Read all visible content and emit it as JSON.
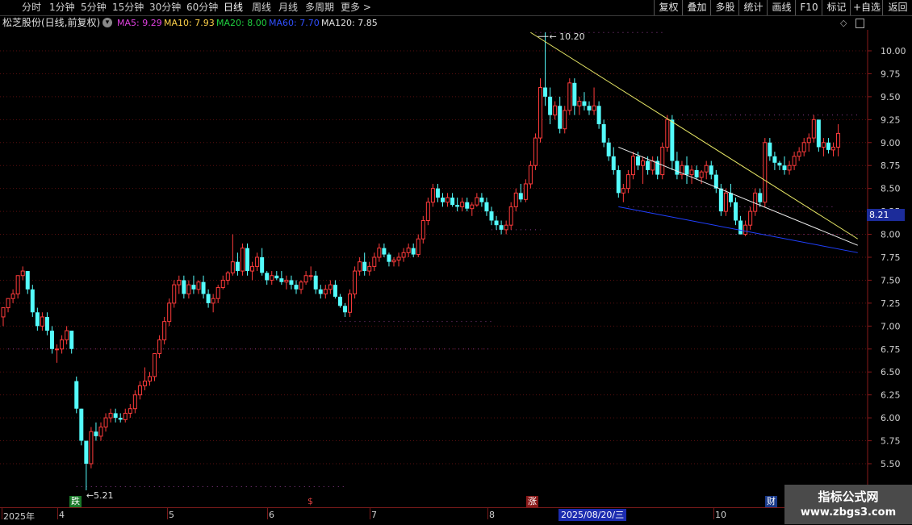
{
  "toolbar": {
    "left_items": [
      "分时",
      "1分钟",
      "5分钟",
      "15分钟",
      "30分钟",
      "60分钟",
      "日线",
      "周线",
      "月线",
      "多周期",
      "更多 >"
    ],
    "active_index": 6,
    "right_items": [
      "复权",
      "叠加",
      "多股",
      "统计",
      "画线",
      "F10",
      "标记",
      "+自选",
      "返回"
    ]
  },
  "info": {
    "title": "松芝股份(日线,前复权)",
    "dropdown_icon": "circle-chevron-down-icon",
    "ma": [
      {
        "label": "MA5: 9.29",
        "color": "#e040e0"
      },
      {
        "label": "MA10: 7.93",
        "color": "#ffd24a"
      },
      {
        "label": "MA20: 8.00",
        "color": "#20d040"
      },
      {
        "label": "MA60: 7.70",
        "color": "#3050ff"
      },
      {
        "label": "MA120: 7.85",
        "color": "#e0e0e0"
      }
    ]
  },
  "colors": {
    "up": "#ff3b3b",
    "down": "#54fcfc",
    "axis": "#8a1a1a",
    "grid": "#5a0f0f"
  },
  "chart_data": {
    "type": "candlestick",
    "stock": "松芝股份",
    "period": "日线",
    "adjust": "前复权",
    "ylim": [
      5.3,
      10.25
    ],
    "y_ticks": [
      10.0,
      9.75,
      9.5,
      9.25,
      9.0,
      8.75,
      8.5,
      8.25,
      8.0,
      7.75,
      7.5,
      7.25,
      7.0,
      6.75,
      6.5,
      6.25,
      6.0,
      5.75,
      5.5
    ],
    "y_tick_labels": [
      "10.00",
      "9.75",
      "9.50",
      "9.25",
      "9.00",
      "8.75",
      "8.50",
      "8.25",
      "8.00",
      "7.75",
      "7.50",
      "7.25",
      "7.00",
      "6.75",
      "6.50",
      "6.25",
      "6.00",
      "5.75",
      "5.50"
    ],
    "current_price_label": "8.21",
    "current_price": 8.21,
    "high_annotation": "10.20",
    "high_value": 10.2,
    "low_annotation": "5.21",
    "low_value": 5.21,
    "x_labels": [
      "2025年",
      "4",
      "5",
      "6",
      "7",
      "8",
      "10"
    ],
    "cursor_date": "2025/08/20/三",
    "markers": [
      {
        "text": "跌",
        "bar": 15,
        "color": "#20c040"
      },
      {
        "text": "$",
        "bar": 64,
        "color": "#e04040"
      },
      {
        "text": "涨",
        "bar": 109,
        "color": "#e04040"
      },
      {
        "text": "财",
        "bar": 159,
        "color": "#4080ff"
      }
    ],
    "candles": [
      [
        7.1,
        7.2,
        7.0,
        7.2
      ],
      [
        7.2,
        7.3,
        7.15,
        7.3
      ],
      [
        7.3,
        7.4,
        7.25,
        7.35
      ],
      [
        7.35,
        7.55,
        7.3,
        7.55
      ],
      [
        7.55,
        7.65,
        7.5,
        7.6
      ],
      [
        7.6,
        7.6,
        7.35,
        7.4
      ],
      [
        7.4,
        7.45,
        7.1,
        7.15
      ],
      [
        7.15,
        7.2,
        6.95,
        7.0
      ],
      [
        7.0,
        7.15,
        6.95,
        7.1
      ],
      [
        7.1,
        7.15,
        6.9,
        6.95
      ],
      [
        6.95,
        7.0,
        6.7,
        6.75
      ],
      [
        6.75,
        6.8,
        6.6,
        6.75
      ],
      [
        6.75,
        6.9,
        6.7,
        6.85
      ],
      [
        6.85,
        7.0,
        6.8,
        6.95
      ],
      [
        6.95,
        6.95,
        6.7,
        6.75
      ],
      [
        6.4,
        6.45,
        6.05,
        6.1
      ],
      [
        6.1,
        6.1,
        5.7,
        5.75
      ],
      [
        5.75,
        5.75,
        5.21,
        5.5
      ],
      [
        5.5,
        5.9,
        5.45,
        5.85
      ],
      [
        5.85,
        5.95,
        5.75,
        5.8
      ],
      [
        5.8,
        5.95,
        5.75,
        5.9
      ],
      [
        5.9,
        6.05,
        5.85,
        6.0
      ],
      [
        6.0,
        6.1,
        5.95,
        6.05
      ],
      [
        6.05,
        6.1,
        5.95,
        6.0
      ],
      [
        6.0,
        6.05,
        5.95,
        5.98
      ],
      [
        5.98,
        6.1,
        5.95,
        6.05
      ],
      [
        6.05,
        6.15,
        6.0,
        6.1
      ],
      [
        6.1,
        6.3,
        6.05,
        6.25
      ],
      [
        6.25,
        6.4,
        6.2,
        6.35
      ],
      [
        6.35,
        6.55,
        6.3,
        6.4
      ],
      [
        6.4,
        6.5,
        6.35,
        6.45
      ],
      [
        6.45,
        6.7,
        6.4,
        6.7
      ],
      [
        6.7,
        6.9,
        6.65,
        6.85
      ],
      [
        6.85,
        7.1,
        6.8,
        7.05
      ],
      [
        7.05,
        7.3,
        7.0,
        7.25
      ],
      [
        7.25,
        7.5,
        7.2,
        7.45
      ],
      [
        7.45,
        7.55,
        7.35,
        7.5
      ],
      [
        7.5,
        7.55,
        7.3,
        7.35
      ],
      [
        7.35,
        7.5,
        7.3,
        7.45
      ],
      [
        7.45,
        7.55,
        7.35,
        7.4
      ],
      [
        7.4,
        7.5,
        7.35,
        7.48
      ],
      [
        7.48,
        7.55,
        7.3,
        7.35
      ],
      [
        7.35,
        7.4,
        7.2,
        7.25
      ],
      [
        7.25,
        7.35,
        7.15,
        7.3
      ],
      [
        7.3,
        7.45,
        7.25,
        7.42
      ],
      [
        7.42,
        7.55,
        7.4,
        7.5
      ],
      [
        7.5,
        7.6,
        7.45,
        7.58
      ],
      [
        7.58,
        8.0,
        7.55,
        7.7
      ],
      [
        7.7,
        7.8,
        7.55,
        7.6
      ],
      [
        7.6,
        7.9,
        7.55,
        7.85
      ],
      [
        7.85,
        7.9,
        7.55,
        7.6
      ],
      [
        7.6,
        7.7,
        7.5,
        7.65
      ],
      [
        7.65,
        7.8,
        7.6,
        7.75
      ],
      [
        7.75,
        7.85,
        7.55,
        7.58
      ],
      [
        7.58,
        7.6,
        7.45,
        7.5
      ],
      [
        7.5,
        7.6,
        7.45,
        7.55
      ],
      [
        7.55,
        7.6,
        7.5,
        7.52
      ],
      [
        7.52,
        7.6,
        7.45,
        7.48
      ],
      [
        7.48,
        7.55,
        7.4,
        7.5
      ],
      [
        7.5,
        7.55,
        7.4,
        7.45
      ],
      [
        7.45,
        7.5,
        7.35,
        7.4
      ],
      [
        7.4,
        7.5,
        7.35,
        7.48
      ],
      [
        7.48,
        7.6,
        7.45,
        7.55
      ],
      [
        7.55,
        7.65,
        7.5,
        7.55
      ],
      [
        7.55,
        7.6,
        7.35,
        7.4
      ],
      [
        7.4,
        7.45,
        7.3,
        7.35
      ],
      [
        7.35,
        7.45,
        7.3,
        7.4
      ],
      [
        7.4,
        7.5,
        7.35,
        7.45
      ],
      [
        7.45,
        7.5,
        7.3,
        7.32
      ],
      [
        7.32,
        7.35,
        7.2,
        7.22
      ],
      [
        7.22,
        7.25,
        7.1,
        7.15
      ],
      [
        7.15,
        7.4,
        7.1,
        7.35
      ],
      [
        7.35,
        7.65,
        7.3,
        7.6
      ],
      [
        7.6,
        7.75,
        7.55,
        7.7
      ],
      [
        7.7,
        7.8,
        7.55,
        7.6
      ],
      [
        7.6,
        7.7,
        7.55,
        7.65
      ],
      [
        7.65,
        7.8,
        7.6,
        7.75
      ],
      [
        7.75,
        7.9,
        7.7,
        7.85
      ],
      [
        7.85,
        7.9,
        7.75,
        7.78
      ],
      [
        7.78,
        7.8,
        7.65,
        7.7
      ],
      [
        7.7,
        7.75,
        7.65,
        7.72
      ],
      [
        7.72,
        7.8,
        7.65,
        7.75
      ],
      [
        7.75,
        7.85,
        7.7,
        7.8
      ],
      [
        7.8,
        7.9,
        7.75,
        7.85
      ],
      [
        7.85,
        7.9,
        7.75,
        7.78
      ],
      [
        7.78,
        8.0,
        7.75,
        7.95
      ],
      [
        7.95,
        8.2,
        7.9,
        8.15
      ],
      [
        8.15,
        8.4,
        8.1,
        8.35
      ],
      [
        8.35,
        8.55,
        8.3,
        8.5
      ],
      [
        8.5,
        8.55,
        8.35,
        8.4
      ],
      [
        8.4,
        8.45,
        8.3,
        8.35
      ],
      [
        8.35,
        8.45,
        8.3,
        8.4
      ],
      [
        8.4,
        8.45,
        8.3,
        8.32
      ],
      [
        8.32,
        8.4,
        8.25,
        8.3
      ],
      [
        8.3,
        8.4,
        8.25,
        8.35
      ],
      [
        8.35,
        8.4,
        8.25,
        8.28
      ],
      [
        8.28,
        8.35,
        8.2,
        8.32
      ],
      [
        8.32,
        8.45,
        8.3,
        8.4
      ],
      [
        8.4,
        8.45,
        8.3,
        8.35
      ],
      [
        8.35,
        8.4,
        8.2,
        8.25
      ],
      [
        8.25,
        8.3,
        8.1,
        8.15
      ],
      [
        8.15,
        8.2,
        8.05,
        8.1
      ],
      [
        8.1,
        8.15,
        8.0,
        8.05
      ],
      [
        8.05,
        8.15,
        8.0,
        8.1
      ],
      [
        8.1,
        8.35,
        8.05,
        8.3
      ],
      [
        8.3,
        8.5,
        8.25,
        8.45
      ],
      [
        8.45,
        8.55,
        8.35,
        8.38
      ],
      [
        8.38,
        8.6,
        8.35,
        8.55
      ],
      [
        8.55,
        8.8,
        8.5,
        8.75
      ],
      [
        8.75,
        9.1,
        8.7,
        9.05
      ],
      [
        9.05,
        9.7,
        9.0,
        9.6
      ],
      [
        9.6,
        10.2,
        9.4,
        9.5
      ],
      [
        9.5,
        9.6,
        9.2,
        9.3
      ],
      [
        9.3,
        9.45,
        9.25,
        9.4
      ],
      [
        9.4,
        9.5,
        9.1,
        9.15
      ],
      [
        9.15,
        9.4,
        9.1,
        9.35
      ],
      [
        9.35,
        9.7,
        9.3,
        9.65
      ],
      [
        9.65,
        9.7,
        9.3,
        9.4
      ],
      [
        9.4,
        9.5,
        9.3,
        9.45
      ],
      [
        9.45,
        9.55,
        9.35,
        9.4
      ],
      [
        9.4,
        9.45,
        9.3,
        9.35
      ],
      [
        9.35,
        9.6,
        9.3,
        9.4
      ],
      [
        9.4,
        9.45,
        9.15,
        9.2
      ],
      [
        9.2,
        9.25,
        8.95,
        9.0
      ],
      [
        9.0,
        9.05,
        8.8,
        8.85
      ],
      [
        8.85,
        8.95,
        8.65,
        8.7
      ],
      [
        8.7,
        8.75,
        8.4,
        8.45
      ],
      [
        8.45,
        8.55,
        8.35,
        8.5
      ],
      [
        8.5,
        8.7,
        8.45,
        8.65
      ],
      [
        8.65,
        8.9,
        8.6,
        8.85
      ],
      [
        8.85,
        8.9,
        8.7,
        8.75
      ],
      [
        8.75,
        8.85,
        8.55,
        8.8
      ],
      [
        8.8,
        8.85,
        8.65,
        8.7
      ],
      [
        8.7,
        8.85,
        8.65,
        8.8
      ],
      [
        8.8,
        8.85,
        8.6,
        8.65
      ],
      [
        8.65,
        9.0,
        8.6,
        8.95
      ],
      [
        8.95,
        9.3,
        8.9,
        9.25
      ],
      [
        9.25,
        9.3,
        8.7,
        8.8
      ],
      [
        8.8,
        8.9,
        8.6,
        8.65
      ],
      [
        8.65,
        8.8,
        8.6,
        8.75
      ],
      [
        8.75,
        8.85,
        8.55,
        8.65
      ],
      [
        8.65,
        8.75,
        8.55,
        8.7
      ],
      [
        8.7,
        8.75,
        8.6,
        8.62
      ],
      [
        8.62,
        8.7,
        8.55,
        8.68
      ],
      [
        8.68,
        8.8,
        8.6,
        8.75
      ],
      [
        8.75,
        8.8,
        8.6,
        8.65
      ],
      [
        8.65,
        8.7,
        8.45,
        8.5
      ],
      [
        8.5,
        8.55,
        8.2,
        8.25
      ],
      [
        8.25,
        8.5,
        8.2,
        8.45
      ],
      [
        8.45,
        8.55,
        8.3,
        8.35
      ],
      [
        8.35,
        8.4,
        8.1,
        8.15
      ],
      [
        8.15,
        8.2,
        8.0,
        8.0
      ],
      [
        8.0,
        8.15,
        7.98,
        8.1
      ],
      [
        8.1,
        8.3,
        8.05,
        8.25
      ],
      [
        8.25,
        8.5,
        8.2,
        8.45
      ],
      [
        8.45,
        8.5,
        8.3,
        8.35
      ],
      [
        8.35,
        9.05,
        8.3,
        9.0
      ],
      [
        9.0,
        9.05,
        8.8,
        8.85
      ],
      [
        8.85,
        8.9,
        8.7,
        8.78
      ],
      [
        8.78,
        8.8,
        8.7,
        8.75
      ],
      [
        8.75,
        8.85,
        8.65,
        8.7
      ],
      [
        8.7,
        8.8,
        8.65,
        8.75
      ],
      [
        8.75,
        8.9,
        8.7,
        8.85
      ],
      [
        8.85,
        8.95,
        8.8,
        8.9
      ],
      [
        8.9,
        9.05,
        8.85,
        9.0
      ],
      [
        9.0,
        9.1,
        8.9,
        9.05
      ],
      [
        9.05,
        9.3,
        9.0,
        9.25
      ],
      [
        9.25,
        9.25,
        8.9,
        8.95
      ],
      [
        8.95,
        9.05,
        8.85,
        9.0
      ],
      [
        9.0,
        9.05,
        8.88,
        8.92
      ],
      [
        8.92,
        9.0,
        8.85,
        8.95
      ],
      [
        8.95,
        9.2,
        8.85,
        9.1
      ]
    ],
    "trendlines": [
      {
        "from": [
          108,
          10.2
        ],
        "to": [
          175,
          7.95
        ],
        "color": "#e8e866"
      },
      {
        "from": [
          126,
          8.95
        ],
        "to": [
          175,
          7.88
        ],
        "color": "#f0f0f0"
      },
      {
        "from": [
          126,
          8.3
        ],
        "to": [
          175,
          7.8
        ],
        "color": "#2040ff"
      }
    ]
  }
}
